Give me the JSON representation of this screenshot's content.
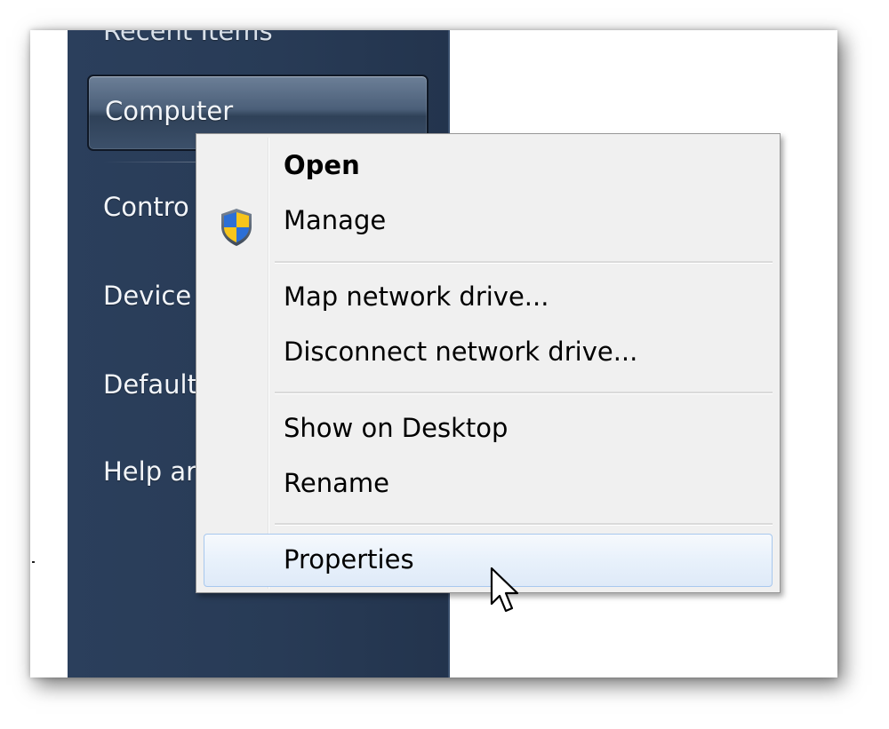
{
  "start_menu": {
    "items": [
      {
        "label": "Recent Items"
      },
      {
        "label": "Computer"
      },
      {
        "label": "Contro"
      },
      {
        "label": "Device"
      },
      {
        "label": "Default"
      },
      {
        "label": "Help ar"
      }
    ]
  },
  "context_menu": {
    "items": [
      {
        "label": "Open",
        "bold": true
      },
      {
        "label": "Manage",
        "icon": "uac-shield-icon"
      },
      {
        "label": "Map network drive..."
      },
      {
        "label": "Disconnect network drive..."
      },
      {
        "label": "Show on Desktop"
      },
      {
        "label": "Rename"
      },
      {
        "label": "Properties",
        "state": "hover"
      }
    ]
  },
  "colors": {
    "start_panel": "#283b56",
    "menu_background": "#f0f0f0",
    "hover_border": "#a8c8ee"
  }
}
